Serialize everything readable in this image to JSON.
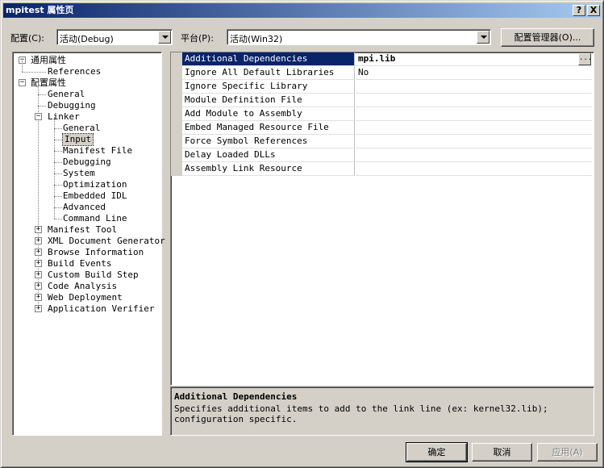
{
  "window": {
    "title": "mpitest 属性页",
    "help_button": "?",
    "close_button": "X"
  },
  "toolbar": {
    "config_label": "配置(C):",
    "config_value": "活动(Debug)",
    "platform_label": "平台(P):",
    "platform_value": "活动(Win32)",
    "config_manager_button": "配置管理器(O)..."
  },
  "tree": {
    "common_props": "通用属性",
    "references": "References",
    "config_props": "配置属性",
    "general": "General",
    "debugging": "Debugging",
    "linker": "Linker",
    "linker_children": [
      "General",
      "Input",
      "Manifest File",
      "Debugging",
      "System",
      "Optimization",
      "Embedded IDL",
      "Advanced",
      "Command Line"
    ],
    "collapsed": [
      "Manifest Tool",
      "XML Document Generator",
      "Browse Information",
      "Build Events",
      "Custom Build Step",
      "Code Analysis",
      "Web Deployment",
      "Application Verifier"
    ],
    "expander_minus": "−",
    "expander_plus": "+"
  },
  "grid": {
    "rows": [
      {
        "name": "Additional Dependencies",
        "value": "mpi.lib"
      },
      {
        "name": "Ignore All Default Libraries",
        "value": "No"
      },
      {
        "name": "Ignore Specific Library",
        "value": ""
      },
      {
        "name": "Module Definition File",
        "value": ""
      },
      {
        "name": "Add Module to Assembly",
        "value": ""
      },
      {
        "name": "Embed Managed Resource File",
        "value": ""
      },
      {
        "name": "Force Symbol References",
        "value": ""
      },
      {
        "name": "Delay Loaded DLLs",
        "value": ""
      },
      {
        "name": "Assembly Link Resource",
        "value": ""
      }
    ],
    "ellipsis": "..."
  },
  "description": {
    "title": "Additional Dependencies",
    "text": "Specifies additional items to add to the link line (ex: kernel32.lib); configuration specific."
  },
  "footer": {
    "ok": "确定",
    "cancel": "取消",
    "apply": "应用(A)"
  }
}
